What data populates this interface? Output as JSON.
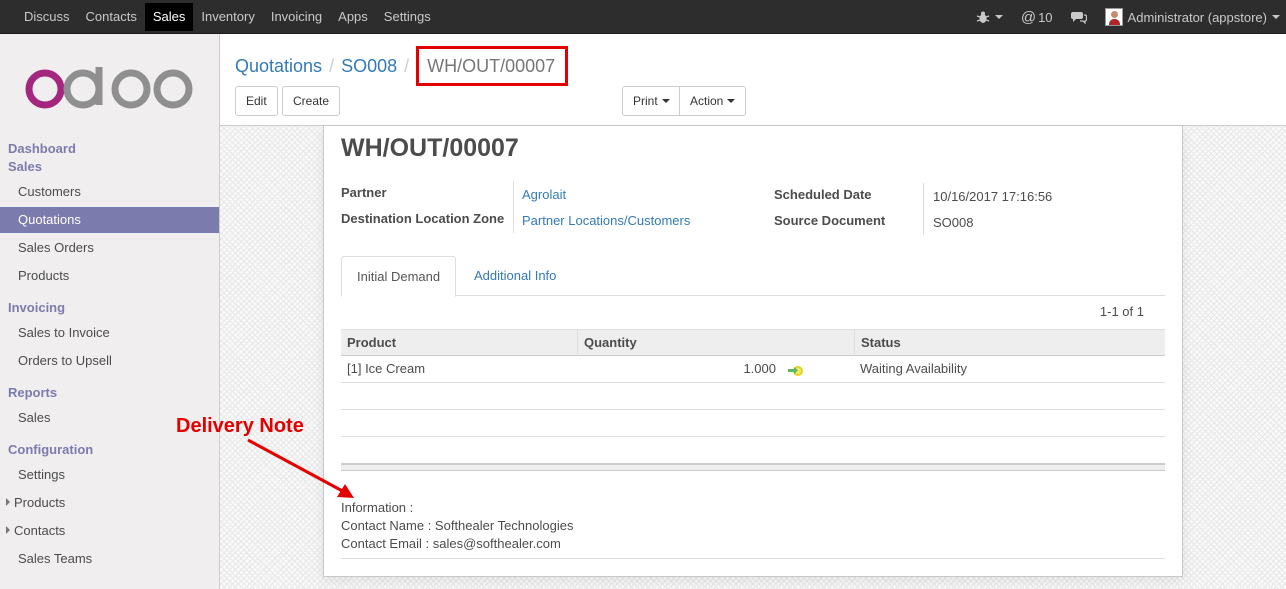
{
  "topbar": {
    "menu": [
      "Discuss",
      "Contacts",
      "Sales",
      "Inventory",
      "Invoicing",
      "Apps",
      "Settings"
    ],
    "active_menu": "Sales",
    "messages_count": "10",
    "user": "Administrator (appstore)"
  },
  "sidebar": {
    "logo_text": "odoo",
    "sections": {
      "dashboard": "Dashboard",
      "sales": "Sales",
      "invoicing": "Invoicing",
      "reports": "Reports",
      "configuration": "Configuration"
    },
    "items": {
      "customers": "Customers",
      "quotations": "Quotations",
      "sales_orders": "Sales Orders",
      "products": "Products",
      "sales_to_invoice": "Sales to Invoice",
      "orders_to_upsell": "Orders to Upsell",
      "reports_sales": "Sales",
      "settings": "Settings",
      "config_products": "Products",
      "config_contacts": "Contacts",
      "sales_teams": "Sales Teams"
    }
  },
  "breadcrumb": {
    "level1": "Quotations",
    "level2": "SO008",
    "current": "WH/OUT/00007"
  },
  "buttons": {
    "edit": "Edit",
    "create": "Create",
    "print": "Print",
    "action": "Action"
  },
  "form": {
    "title": "WH/OUT/00007",
    "partner_label": "Partner",
    "partner_value": "Agrolait",
    "dest_label": "Destination Location Zone",
    "dest_value": "Partner Locations/Customers",
    "scheduled_label": "Scheduled Date",
    "scheduled_value": "10/16/2017 17:16:56",
    "source_label": "Source Document",
    "source_value": "SO008"
  },
  "tabs": {
    "initial_demand": "Initial Demand",
    "additional_info": "Additional Info"
  },
  "pager": "1-1 of 1",
  "table": {
    "columns": [
      "Product",
      "Quantity",
      "Status"
    ],
    "rows": [
      {
        "product": "[1] Ice Cream",
        "quantity": "1.000",
        "status": "Waiting Availability"
      }
    ]
  },
  "note": {
    "line1": "Information :",
    "line2": "Contact Name : Softhealer Technologies",
    "line3": "Contact Email : sales@softhealer.com"
  },
  "annotation": {
    "label": "Delivery Note",
    "color": "#e30000"
  },
  "colors": {
    "brand": "#7c7bad",
    "link": "#337ab7",
    "topbar": "#2d2d2d"
  }
}
